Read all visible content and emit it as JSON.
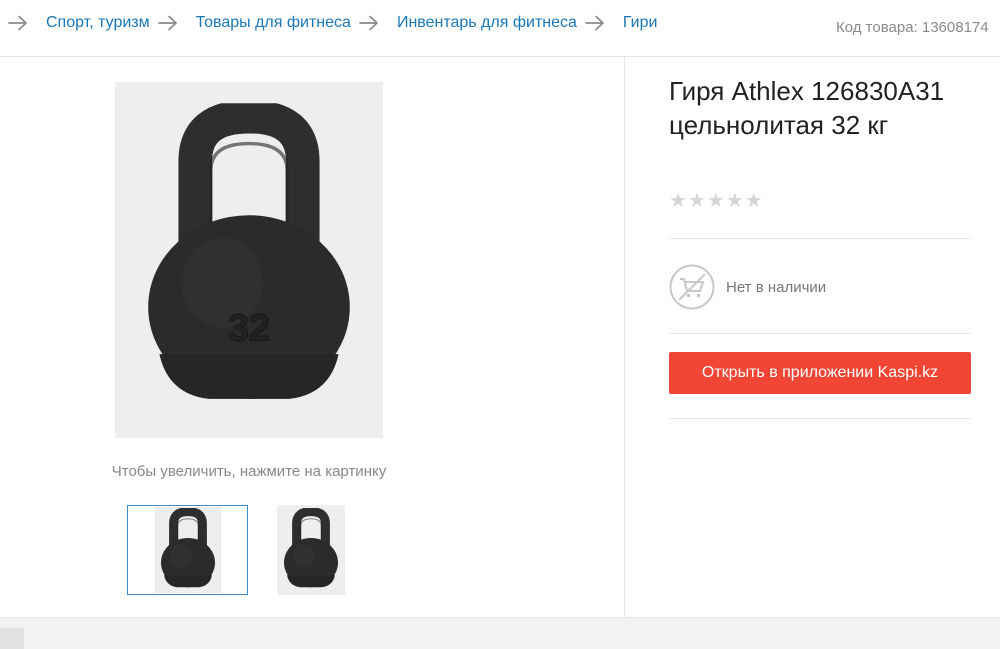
{
  "breadcrumbs": [
    "Спорт, туризм",
    "Товары для фитнеса",
    "Инвентарь для фитнеса",
    "Гири"
  ],
  "product_code": "Код товара: 13608174",
  "product": {
    "title": "Гиря Athlex 126830A31 цельнолитая 32 кг",
    "rating_stars": 0,
    "rating_max": 5,
    "availability": "Нет в наличии",
    "open_app_button": "Открыть в приложении Kaspi.kz",
    "image_number": "32"
  },
  "gallery": {
    "hint": "Чтобы увеличить, нажмите на картинку",
    "thumbnails": 2,
    "selected": 0
  },
  "colors": {
    "link": "#1a78b8",
    "button": "#f14635",
    "thumb_selected_border": "#3e8fd0",
    "star_empty": "#d6d6d6"
  },
  "icons": [
    "arrow-right-icon",
    "star-icon",
    "cart-unavailable-icon"
  ]
}
